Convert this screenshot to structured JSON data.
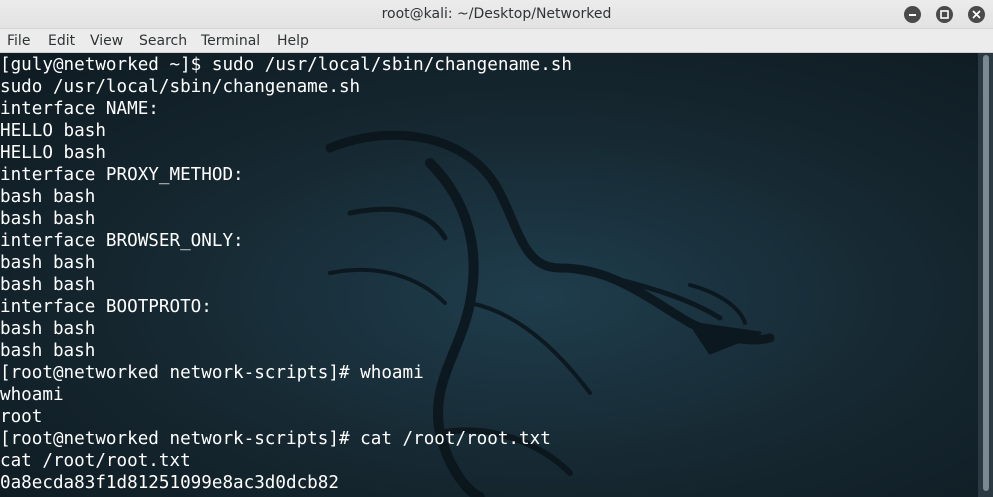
{
  "window": {
    "title": "root@kali: ~/Desktop/Networked"
  },
  "menu": {
    "items": [
      "File",
      "Edit",
      "View",
      "Search",
      "Terminal",
      "Help"
    ]
  },
  "terminal": {
    "lines": [
      "[guly@networked ~]$ sudo /usr/local/sbin/changename.sh",
      "sudo /usr/local/sbin/changename.sh",
      "interface NAME:",
      "HELLO bash",
      "HELLO bash",
      "interface PROXY_METHOD:",
      "bash bash",
      "bash bash",
      "interface BROWSER_ONLY:",
      "bash bash",
      "bash bash",
      "interface BOOTPROTO:",
      "bash bash",
      "bash bash",
      "[root@networked network-scripts]# whoami",
      "whoami",
      "root",
      "[root@networked network-scripts]# cat /root/root.txt",
      "cat /root/root.txt",
      "0a8ecda83f1d81251099e8ac3d0dcb82"
    ],
    "background_icon": "kali-dragon-icon",
    "colors": {
      "background": "#15262f",
      "text": "#ffffff"
    }
  }
}
